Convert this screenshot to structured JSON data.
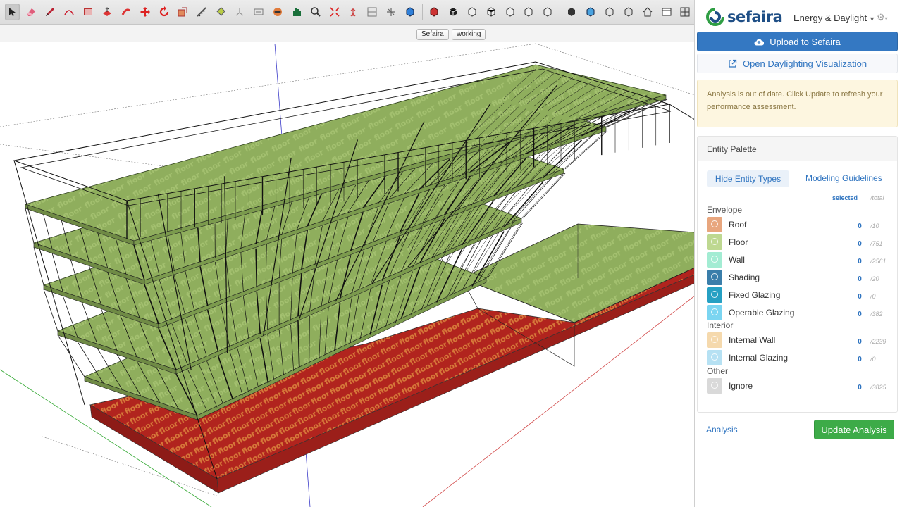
{
  "toolbar": {
    "tools": [
      {
        "name": "select-icon",
        "active": true
      },
      {
        "name": "eraser-icon"
      },
      {
        "name": "pencil-icon"
      },
      {
        "name": "arc-icon"
      },
      {
        "name": "rectangle-icon"
      },
      {
        "name": "push-pull-icon"
      },
      {
        "name": "follow-me-icon"
      },
      {
        "name": "move-icon"
      },
      {
        "name": "rotate-icon"
      },
      {
        "name": "scale-icon"
      },
      {
        "name": "tape-measure-icon"
      },
      {
        "name": "paint-bucket-icon"
      },
      {
        "name": "axes-icon"
      },
      {
        "name": "dimension-icon"
      },
      {
        "name": "orbit-icon"
      },
      {
        "name": "pan-icon"
      },
      {
        "name": "zoom-icon"
      },
      {
        "name": "zoom-extents-icon"
      },
      {
        "name": "walk-icon"
      },
      {
        "name": "section-plane-icon"
      },
      {
        "name": "warehouse-icon"
      },
      {
        "name": "extension-icon"
      },
      {
        "name": "style-icon"
      },
      {
        "name": "iso-view-icon"
      },
      {
        "name": "top-view-icon"
      },
      {
        "name": "front-view-icon"
      },
      {
        "name": "right-view-icon"
      },
      {
        "name": "back-view-icon"
      },
      {
        "name": "left-view-icon"
      },
      {
        "name": "shaded-icon"
      },
      {
        "name": "xray-icon"
      },
      {
        "name": "wireframe-icon"
      },
      {
        "name": "hidden-line-icon"
      },
      {
        "name": "home-icon"
      },
      {
        "name": "window-icon"
      },
      {
        "name": "layout-icon"
      }
    ]
  },
  "tags": {
    "first": "Sefaira",
    "second": "working"
  },
  "viewport": {
    "floor_texture_text": "floor",
    "colors": {
      "slab": "#8fae5d",
      "ground": "#b1241e",
      "axis_red": "#d24a4a",
      "axis_green": "#33a933",
      "axis_blue": "#3a3ac8"
    }
  },
  "panel": {
    "logo_text": "sefaira",
    "mode": "Energy & Daylight",
    "upload_label": "Upload to Sefaira",
    "viz_label": "Open Daylighting Visualization",
    "warning": "Analysis is out of date. Click Update to refresh your performance assessment.",
    "palette": {
      "title": "Entity Palette",
      "hide_label": "Hide Entity Types",
      "guidelines_label": "Modeling Guidelines",
      "col_selected": "selected",
      "col_total": "/total",
      "groups": [
        {
          "label": "Envelope",
          "items": [
            {
              "name": "Roof",
              "selected": "0",
              "total": "/10",
              "color": "#e8a67e"
            },
            {
              "name": "Floor",
              "selected": "0",
              "total": "/751",
              "color": "#bed891"
            },
            {
              "name": "Wall",
              "selected": "0",
              "total": "/2561",
              "color": "#a3ecd3"
            },
            {
              "name": "Shading",
              "selected": "0",
              "total": "/20",
              "color": "#3a7eaa"
            },
            {
              "name": "Fixed Glazing",
              "selected": "0",
              "total": "/0",
              "color": "#26a0c3"
            },
            {
              "name": "Operable Glazing",
              "selected": "0",
              "total": "/382",
              "color": "#7bd5f1"
            }
          ]
        },
        {
          "label": "Interior",
          "items": [
            {
              "name": "Internal Wall",
              "selected": "0",
              "total": "/2239",
              "color": "#f5d9ad"
            },
            {
              "name": "Internal Glazing",
              "selected": "0",
              "total": "/0",
              "color": "#b6e1f3"
            }
          ]
        },
        {
          "label": "Other",
          "items": [
            {
              "name": "Ignore",
              "selected": "0",
              "total": "/3825",
              "color": "#d9d9d9"
            }
          ]
        }
      ]
    },
    "footer": {
      "analysis_link": "Analysis",
      "update_label": "Update Analysis"
    }
  }
}
